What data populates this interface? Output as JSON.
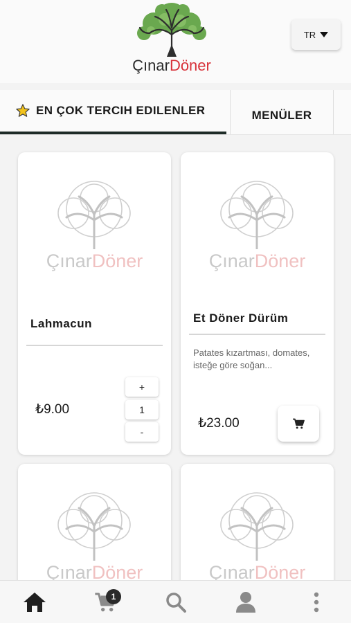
{
  "header": {
    "brand_word1": "Çınar",
    "brand_word2": "Döner",
    "language": "TR"
  },
  "tabs": [
    {
      "label": "EN ÇOK TERCIH EDILENLER",
      "active": true,
      "icon": "star-icon"
    },
    {
      "label": "MENÜLER",
      "active": false
    }
  ],
  "placeholder": {
    "word1": "Çınar",
    "word2": "Döner"
  },
  "products": [
    {
      "name": "Lahmacun",
      "description": "",
      "price": "₺9.00",
      "quantity": "1",
      "plus_label": "+",
      "minus_label": "-"
    },
    {
      "name": "Et Döner Dürüm",
      "description": "Patates kızartması, domates, isteğe göre soğan...",
      "price": "₺23.00"
    }
  ],
  "nav": {
    "items": [
      "home-icon",
      "cart-icon",
      "search-icon",
      "user-icon",
      "more-vertical-icon"
    ],
    "cart_count": "1"
  },
  "colors": {
    "accent": "#1d2b27",
    "brand_red": "#d8323a",
    "star": "#f2c21b"
  }
}
